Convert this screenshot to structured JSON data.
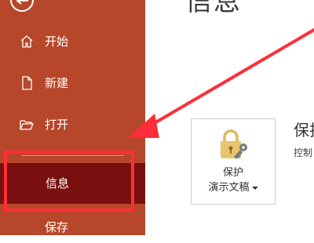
{
  "sidebar": {
    "back_icon": "back-arrow-icon",
    "items": [
      {
        "label": "开始",
        "icon": "home-icon"
      },
      {
        "label": "新建",
        "icon": "new-document-icon"
      },
      {
        "label": "打开",
        "icon": "folder-open-icon"
      },
      {
        "label": "信息",
        "selected": true
      },
      {
        "label": "保存"
      }
    ]
  },
  "main": {
    "title": "信息",
    "protect_button": {
      "line1": "保护",
      "line2": "演示文稿",
      "dropdown_icon": "chevron-down-icon",
      "icon": "lock-key-icon"
    },
    "protect_section": {
      "title": "保护",
      "subtitle": "控制"
    }
  },
  "colors": {
    "sidebar_bg": "#b7472a",
    "selected_bg": "#7a0f0f",
    "annotation_red": "#ff2e3a"
  }
}
